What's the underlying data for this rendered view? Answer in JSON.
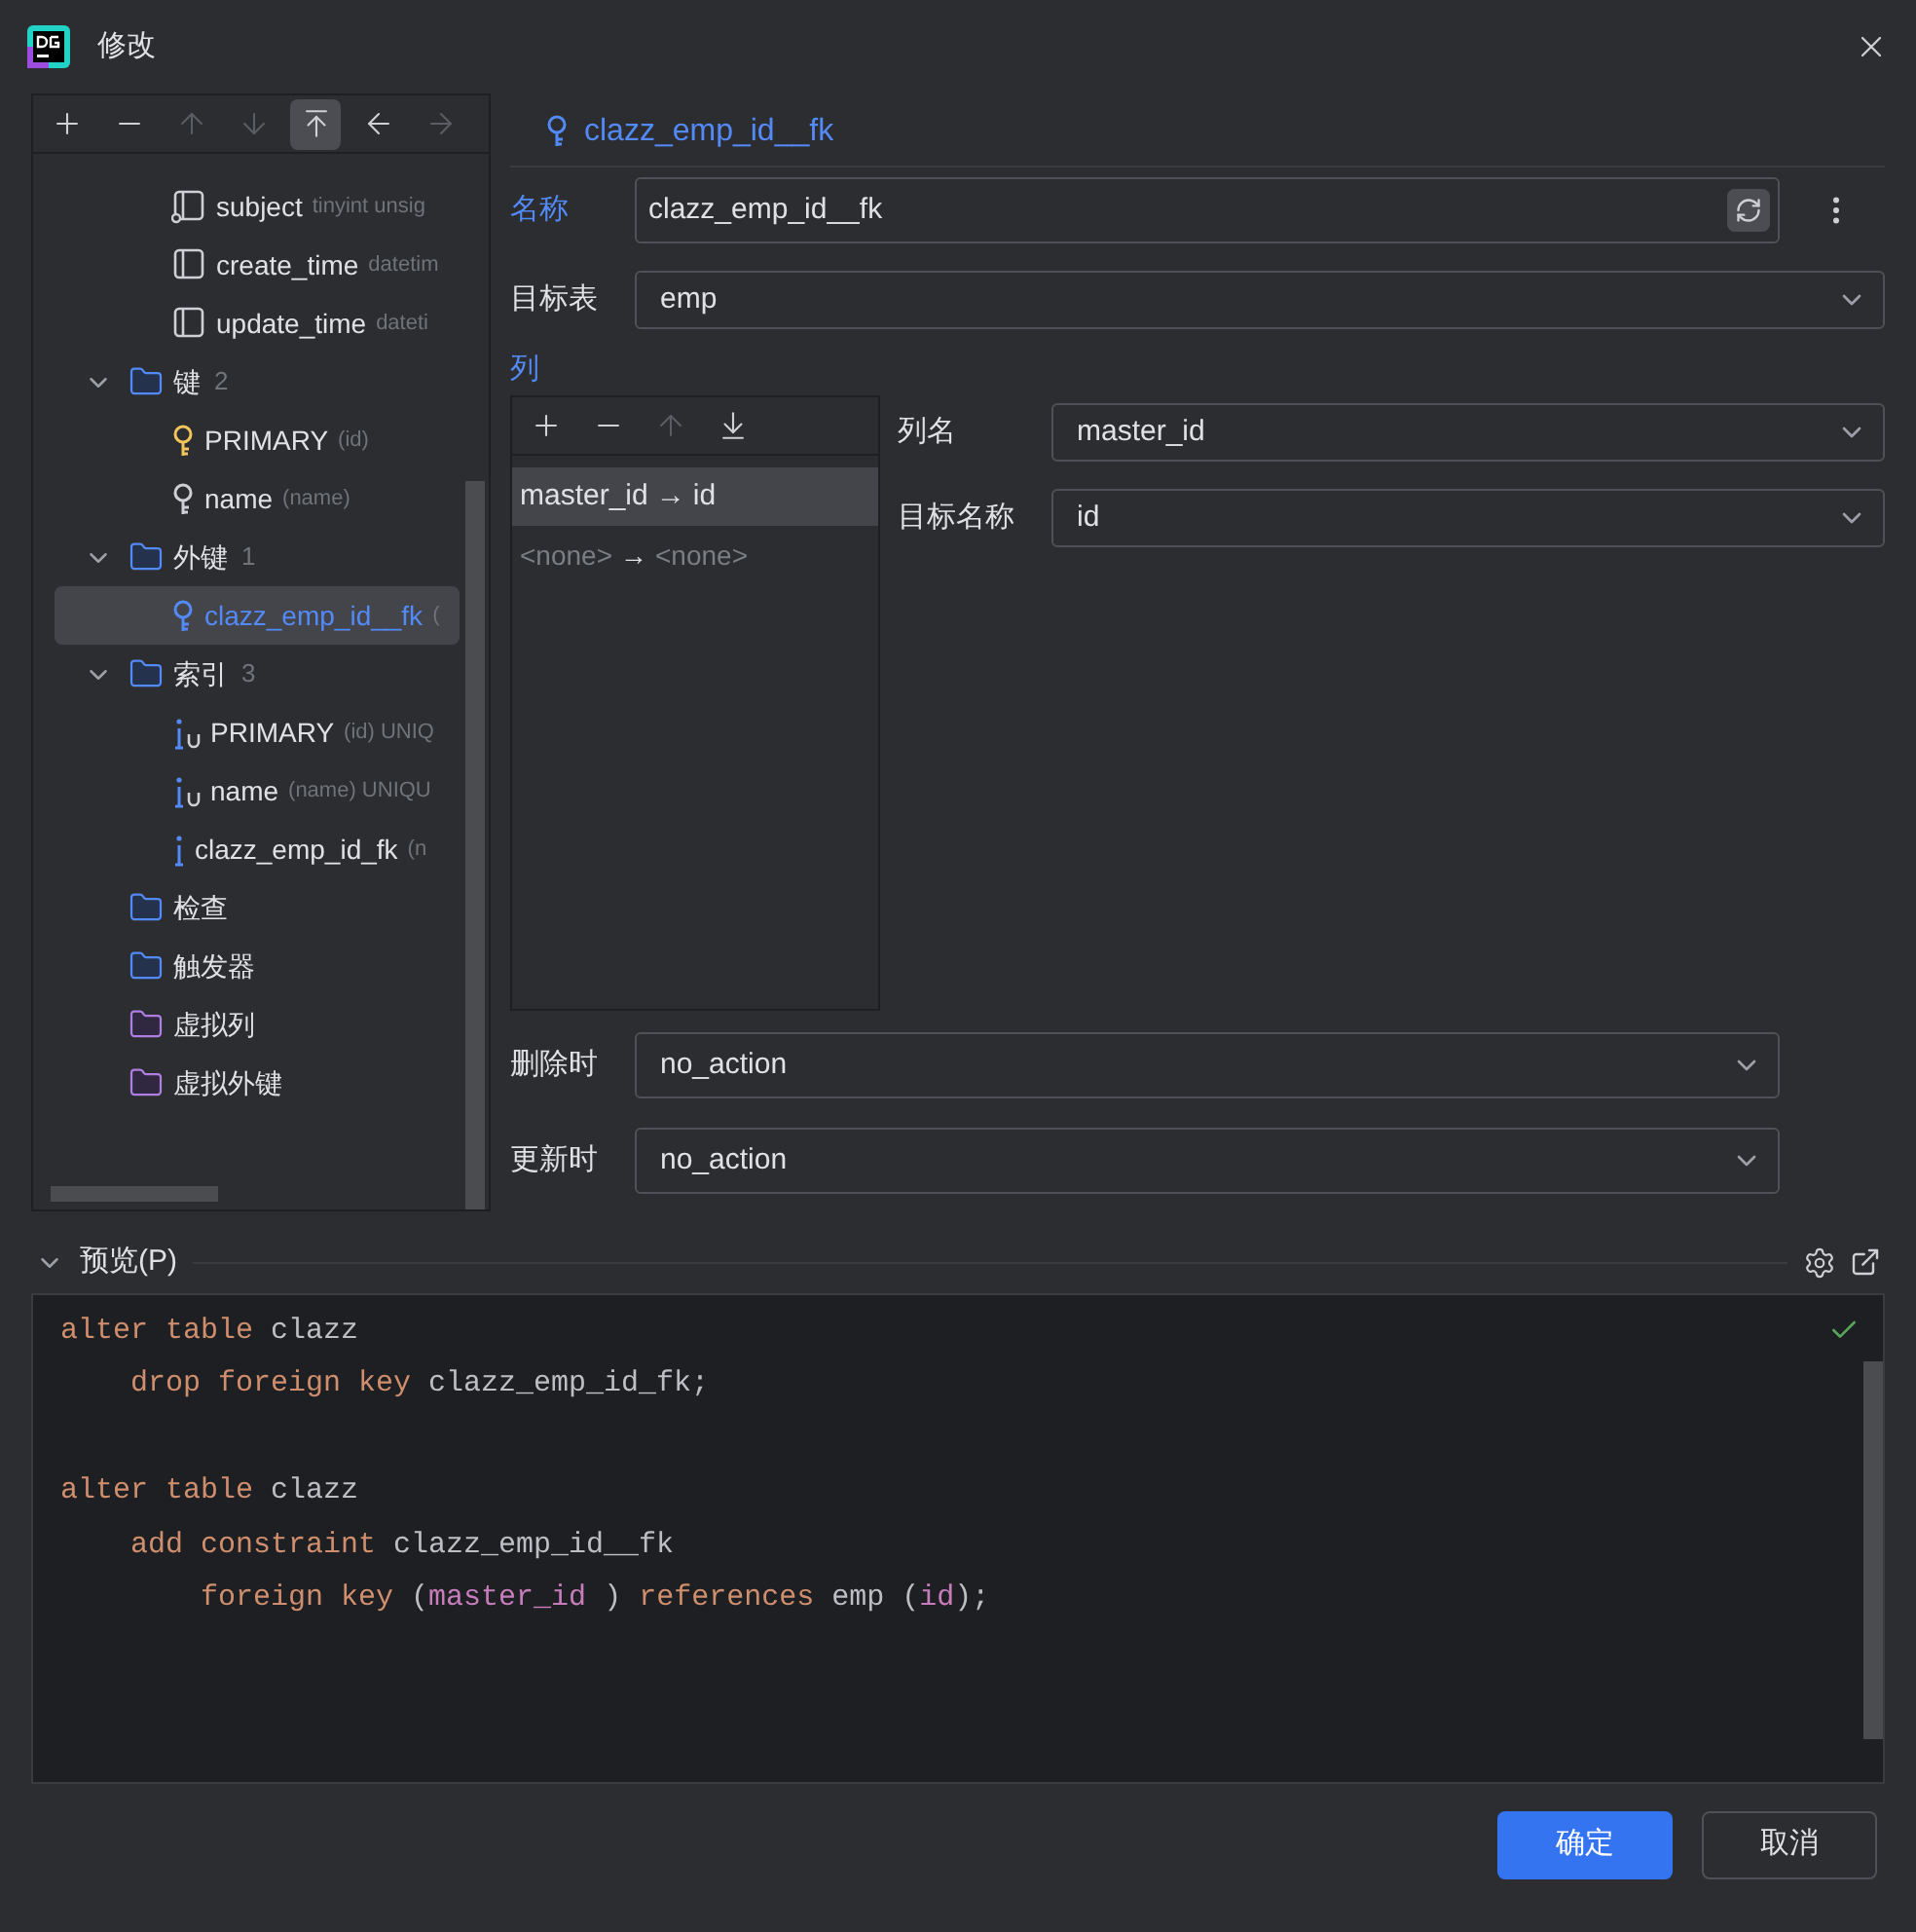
{
  "window": {
    "title": "修改"
  },
  "tree_toolbar": [
    {
      "kind": "add",
      "disabled": false,
      "selected": false
    },
    {
      "kind": "remove",
      "disabled": false,
      "selected": false
    },
    {
      "kind": "up",
      "disabled": true,
      "selected": false
    },
    {
      "kind": "down",
      "disabled": true,
      "selected": false
    },
    {
      "kind": "top",
      "disabled": false,
      "selected": true
    },
    {
      "kind": "back",
      "disabled": false,
      "selected": false
    },
    {
      "kind": "forward",
      "disabled": true,
      "selected": false
    }
  ],
  "tree": {
    "continued_items": [
      {
        "kind": "column",
        "label": "subject",
        "detail": "tinyint unsig",
        "nullable": true,
        "selected": false
      },
      {
        "kind": "column",
        "label": "create_time",
        "detail": "datetim",
        "nullable": false,
        "selected": false
      },
      {
        "kind": "column",
        "label": "update_time",
        "detail": "dateti",
        "nullable": false,
        "selected": false
      }
    ],
    "items": [
      {
        "kind": "folder",
        "label": "键",
        "count": "2",
        "expanded": true,
        "selected": false,
        "children": [
          {
            "kind": "primary_key",
            "label": "PRIMARY",
            "detail": "(id)",
            "selected": false
          },
          {
            "kind": "key",
            "label": "name",
            "detail": "(name)",
            "selected": false
          }
        ]
      },
      {
        "kind": "folder",
        "label": "外键",
        "count": "1",
        "expanded": true,
        "selected": false,
        "children": [
          {
            "kind": "foreign_key",
            "label": "clazz_emp_id__fk",
            "detail": "(",
            "selected": true
          }
        ]
      },
      {
        "kind": "folder",
        "label": "索引",
        "count": "3",
        "expanded": true,
        "selected": false,
        "children": [
          {
            "kind": "unique_index",
            "label": "PRIMARY",
            "detail": "(id) UNIQ",
            "selected": false
          },
          {
            "kind": "unique_index",
            "label": "name",
            "detail": "(name) UNIQU",
            "selected": false
          },
          {
            "kind": "index",
            "label": "clazz_emp_id_fk",
            "detail": "(n",
            "selected": false
          }
        ]
      },
      {
        "kind": "folder",
        "label": "检查",
        "selected": false
      },
      {
        "kind": "folder",
        "label": "触发器",
        "selected": false
      },
      {
        "kind": "virtual_folder",
        "label": "虚拟列",
        "selected": false
      },
      {
        "kind": "virtual_folder",
        "label": "虚拟外键",
        "selected": false
      }
    ]
  },
  "header": {
    "title": "clazz_emp_id__fk"
  },
  "name_field": {
    "label": "名称",
    "value": "clazz_emp_id__fk"
  },
  "target_table": {
    "label": "目标表",
    "value": "emp"
  },
  "columns_section": {
    "label": "列",
    "toolbar": [
      {
        "kind": "add",
        "disabled": false
      },
      {
        "kind": "remove",
        "disabled": false
      },
      {
        "kind": "up",
        "disabled": true
      },
      {
        "kind": "bottom",
        "disabled": false
      }
    ],
    "mappings": [
      {
        "source": "master_id",
        "arrow": "→",
        "target": "id",
        "selected": true,
        "placeholder": false
      },
      {
        "source": "<none>",
        "arrow": "→",
        "target": "<none>",
        "selected": false,
        "placeholder": true
      }
    ],
    "column_name": {
      "label": "列名",
      "value": "master_id"
    },
    "target_name": {
      "label": "目标名称",
      "value": "id"
    }
  },
  "on_delete": {
    "label": "删除时",
    "value": "no_action"
  },
  "on_update": {
    "label": "更新时",
    "value": "no_action"
  },
  "preview": {
    "title": "预览(P)",
    "expanded": true,
    "valid": true,
    "lines": [
      {
        "blank_before": false,
        "tokens": [
          {
            "kind": "keyword",
            "text": "alter table"
          },
          {
            "kind": "plain",
            "text": " clazz"
          }
        ]
      },
      {
        "blank_before": false,
        "tokens": [
          {
            "kind": "keyword",
            "text": "    drop foreign key"
          },
          {
            "kind": "plain",
            "text": " clazz_emp_id_fk;"
          }
        ]
      },
      {
        "blank_before": true,
        "tokens": [
          {
            "kind": "keyword",
            "text": "alter table"
          },
          {
            "kind": "plain",
            "text": " clazz"
          }
        ]
      },
      {
        "blank_before": false,
        "tokens": [
          {
            "kind": "keyword",
            "text": "    add constraint"
          },
          {
            "kind": "plain",
            "text": " clazz_emp_id__fk"
          }
        ]
      },
      {
        "blank_before": false,
        "tokens": [
          {
            "kind": "keyword",
            "text": "        foreign key"
          },
          {
            "kind": "plain",
            "text": " ("
          },
          {
            "kind": "column",
            "text": "master_id"
          },
          {
            "kind": "plain",
            "text": " ) "
          },
          {
            "kind": "keyword",
            "text": "references"
          },
          {
            "kind": "plain",
            "text": " emp ("
          },
          {
            "kind": "column",
            "text": "id"
          },
          {
            "kind": "plain",
            "text": ");"
          }
        ]
      }
    ]
  },
  "buttons": [
    {
      "kind": "primary",
      "label": "确定"
    },
    {
      "kind": "secondary",
      "label": "取消"
    }
  ]
}
